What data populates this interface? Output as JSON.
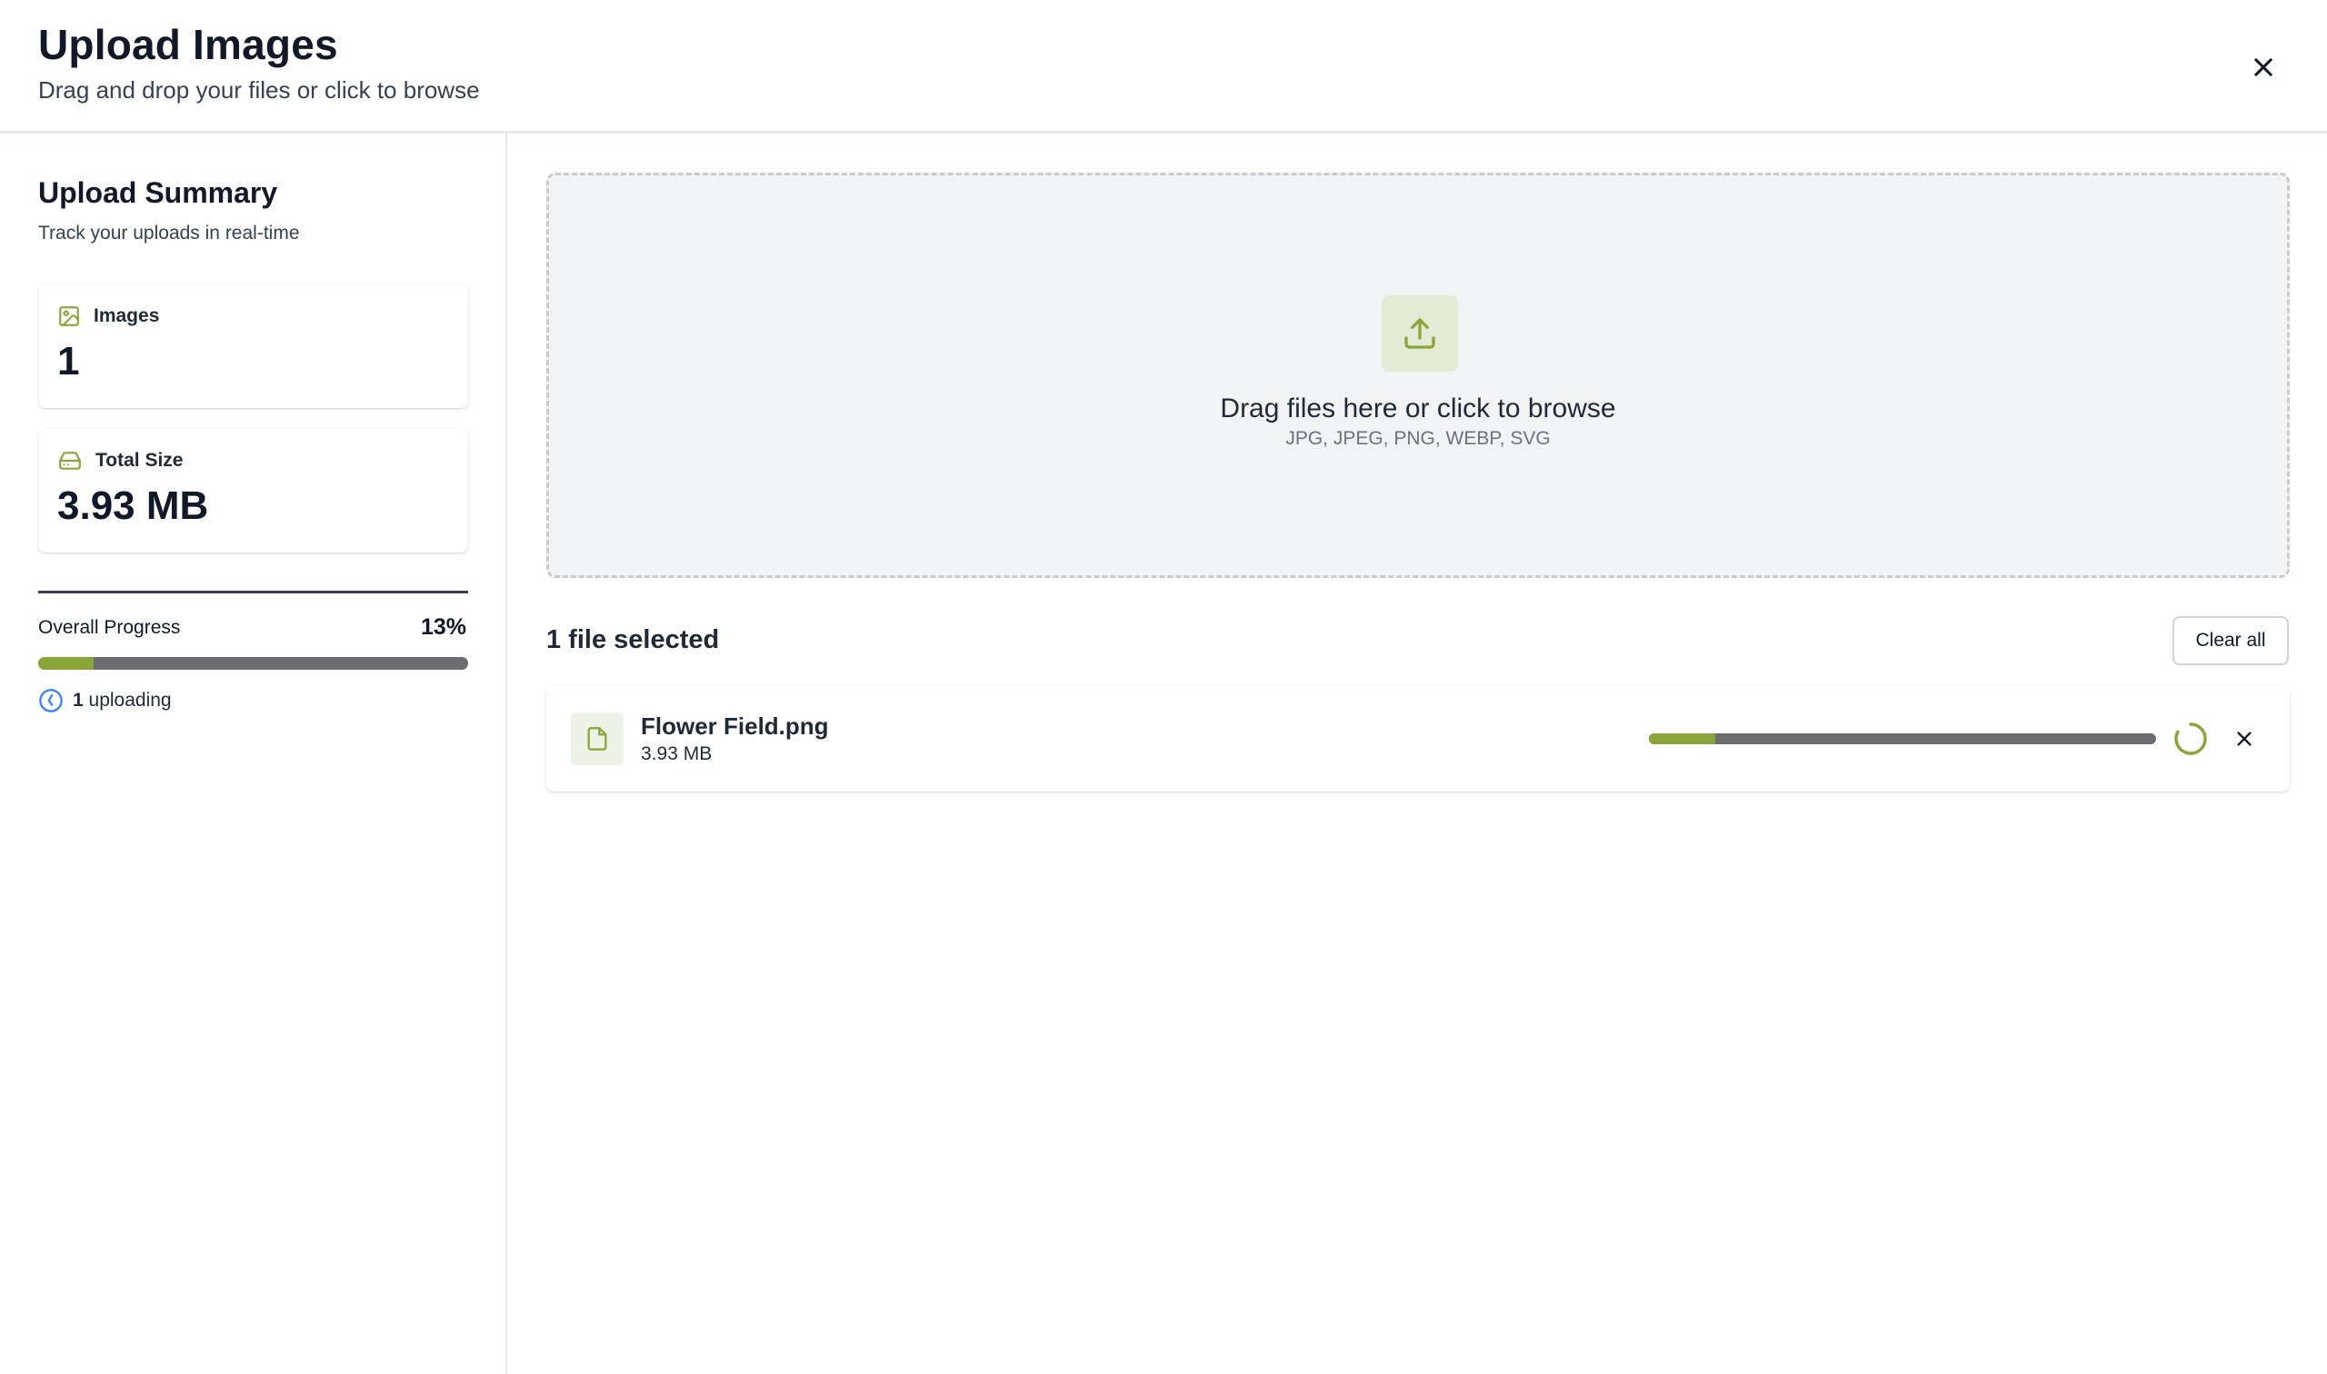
{
  "header": {
    "title": "Upload Images",
    "subtitle": "Drag and drop your files or click to browse",
    "close_icon": "close-icon"
  },
  "sidebar": {
    "title": "Upload Summary",
    "subtitle": "Track your uploads in real-time",
    "stats": [
      {
        "label": "Images",
        "value": "1",
        "icon": "image-icon"
      },
      {
        "label": "Total Size",
        "value": "3.93 MB",
        "icon": "hard-drive-icon"
      }
    ],
    "progress": {
      "label": "Overall Progress",
      "percent_text": "13%",
      "fraction": 0.13
    },
    "uploading": {
      "count": "1",
      "text": " uploading",
      "icon": "clock-icon"
    }
  },
  "dropzone": {
    "icon": "upload-icon",
    "title": "Drag files here or click to browse",
    "formats": "JPG, JPEG, PNG, WEBP, SVG"
  },
  "files": {
    "count_label": "1 file selected",
    "clear_label": "Clear all",
    "items": [
      {
        "name": "Flower Field.png",
        "size": "3.93 MB",
        "progress": 0.13,
        "icon": "file-icon",
        "status_icon": "spinner-icon",
        "remove_icon": "close-icon"
      }
    ]
  },
  "colors": {
    "accent": "#8aa63a",
    "track": "#6b6b70",
    "dropzone_bg": "#f2f3f4",
    "clock_blue": "#3b82f6"
  }
}
